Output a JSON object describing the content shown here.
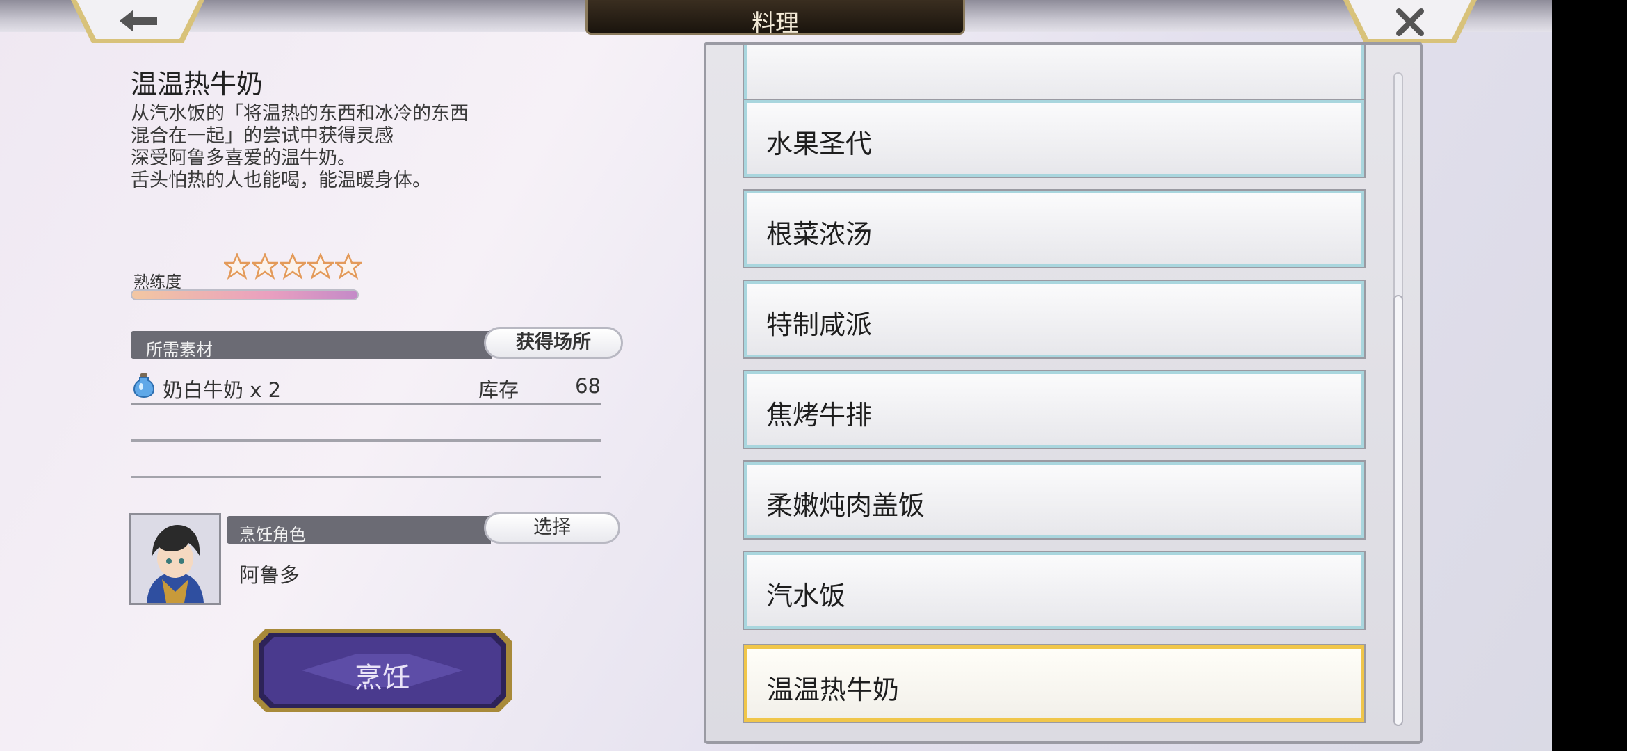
{
  "header": {
    "title": "料理",
    "back_icon": "back-arrow-icon",
    "close_icon": "close-icon"
  },
  "detail": {
    "item_name": "温温热牛奶",
    "description": [
      "从汽水饭的「将温热的东西和冰冷的东西",
      "混合在一起」的尝试中获得灵感",
      "深受阿鲁多喜爱的温牛奶。",
      "舌头怕热的人也能喝，能温暖身体。"
    ],
    "proficiency_label": "熟练度",
    "proficiency_stars": 0,
    "proficiency_max_stars": 5,
    "proficiency_fill": 1.0
  },
  "materials": {
    "header_label": "所需素材",
    "source_button": "获得场所",
    "items": [
      {
        "icon": "milk-bottle-icon",
        "name": "奶白牛奶 x 2",
        "stock_label": "库存",
        "stock": "68"
      }
    ]
  },
  "cook_role": {
    "header_label": "烹饪角色",
    "select_button": "选择",
    "character_name": "阿鲁多",
    "portrait": "character-portrait"
  },
  "cook_button": "烹饪",
  "recipes": [
    {
      "label": "",
      "selected": false
    },
    {
      "label": "水果圣代",
      "selected": false
    },
    {
      "label": "根菜浓汤",
      "selected": false
    },
    {
      "label": "特制咸派",
      "selected": false
    },
    {
      "label": "焦烤牛排",
      "selected": false
    },
    {
      "label": "柔嫩炖肉盖饭",
      "selected": false
    },
    {
      "label": "汽水饭",
      "selected": false
    },
    {
      "label": "温温热牛奶",
      "selected": true
    }
  ],
  "colors": {
    "selected_border": "#f0c64a",
    "item_border": "#a9d6de",
    "header_bar": "#6b6b74",
    "cook_button": "#3b2d6e"
  }
}
